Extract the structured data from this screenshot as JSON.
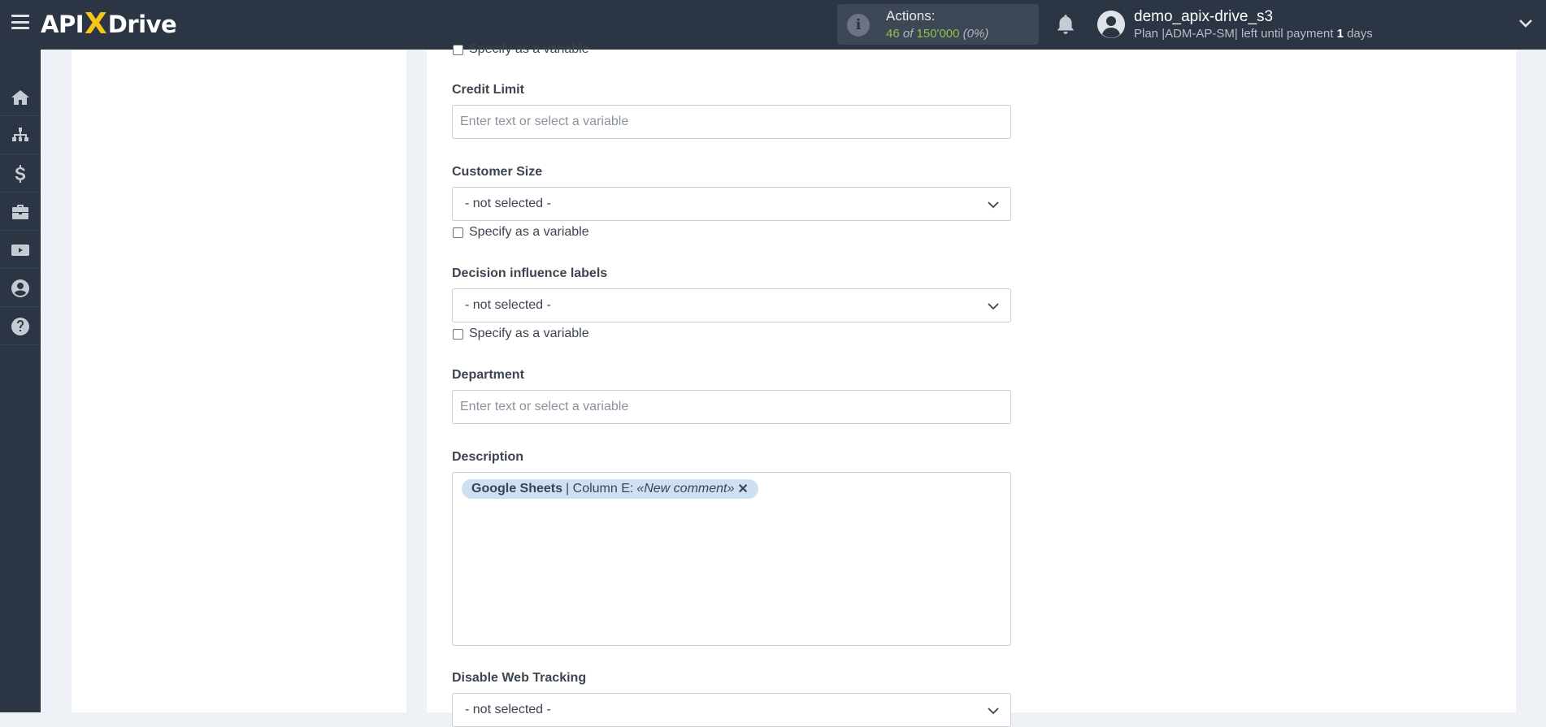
{
  "header": {
    "logo_left": "API",
    "logo_x": "X",
    "logo_right": "Drive",
    "actions_label": "Actions:",
    "actions_used": "46",
    "actions_of": "of",
    "actions_total": "150'000",
    "actions_pct": "(0%)",
    "user_name": "demo_apix-drive_s3",
    "plan_prefix": "Plan |ADM-AP-SM| left until payment",
    "plan_days_num": "1",
    "plan_days_word": "days"
  },
  "sidebar": {
    "icons": [
      "home-icon",
      "sitemap-icon",
      "dollar-icon",
      "briefcase-icon",
      "youtube-icon",
      "user-circle-icon",
      "question-circle-icon"
    ]
  },
  "form": {
    "top_checkbox_label": "Specify as a variable",
    "credit_limit": {
      "label": "Credit Limit",
      "placeholder": "Enter text or select a variable"
    },
    "customer_size": {
      "label": "Customer Size",
      "value": "- not selected -",
      "checkbox_label": "Specify as a variable"
    },
    "decision_influence": {
      "label": "Decision influence labels",
      "value": "- not selected -",
      "checkbox_label": "Specify as a variable"
    },
    "department": {
      "label": "Department",
      "placeholder": "Enter text or select a variable"
    },
    "description": {
      "label": "Description",
      "tag_source": "Google Sheets",
      "tag_column": "| Column E:",
      "tag_value": "«New comment»",
      "tag_remove": "✕"
    },
    "disable_web_tracking": {
      "label": "Disable Web Tracking",
      "value": "- not selected -"
    }
  },
  "colors": {
    "topbar": "#2b3543",
    "accent_green": "#8bc34a",
    "logo_x": "#f5c518",
    "tag_bg": "#cfe0f3"
  }
}
